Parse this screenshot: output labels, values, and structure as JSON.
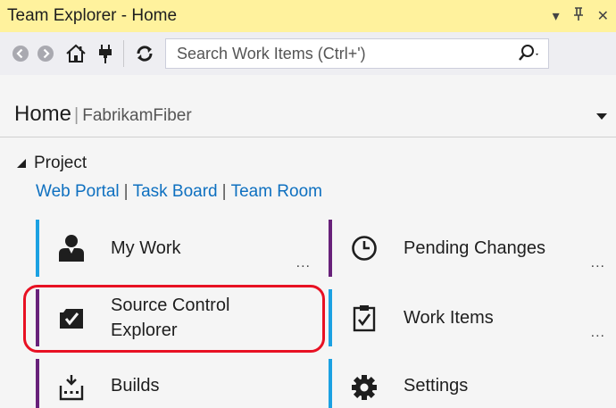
{
  "window": {
    "title": "Team Explorer - Home",
    "controls": {
      "dropdown": "▾",
      "pin": "ᛞ",
      "close": "✕"
    }
  },
  "toolbar": {
    "search_placeholder": "Search Work Items (Ctrl+')",
    "icons": [
      "back-icon",
      "forward-icon",
      "home-icon",
      "connect-icon",
      "refresh-icon",
      "search-icon"
    ]
  },
  "header": {
    "title": "Home",
    "separator": "|",
    "project": "FabrikamFiber"
  },
  "project_section": {
    "heading": "Project",
    "links": [
      "Web Portal",
      "Task Board",
      "Team Room"
    ],
    "separator": "|"
  },
  "tiles": [
    {
      "label": "My Work",
      "more": "...",
      "icon": "person-icon",
      "accent": "#1ba1e2"
    },
    {
      "label": "Pending Changes",
      "more": "...",
      "icon": "clock-icon",
      "accent": "#68217a"
    },
    {
      "label_line1": "Source Control",
      "label_line2": "Explorer",
      "icon": "folder-check-icon",
      "accent": "#68217a"
    },
    {
      "label": "Work Items",
      "more": "...",
      "icon": "clipboard-check-icon",
      "accent": "#1ba1e2"
    },
    {
      "label": "Builds",
      "icon": "build-icon",
      "accent": "#68217a"
    },
    {
      "label": "Settings",
      "icon": "gear-icon",
      "accent": "#1ba1e2"
    }
  ],
  "colors": {
    "title_bar": "#fff29d",
    "link": "#0e70c0",
    "highlight": "#e81123"
  }
}
